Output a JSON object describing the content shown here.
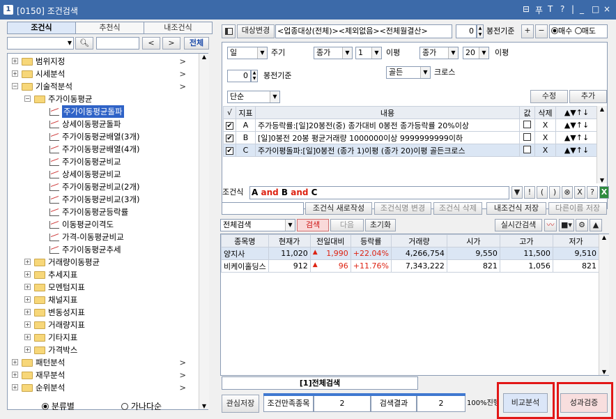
{
  "window": {
    "number": "1",
    "title": "[0150] 조건검색",
    "controls": [
      "⊟",
      "푸",
      "T",
      "?",
      "|",
      "_",
      "□",
      "×"
    ]
  },
  "left": {
    "tabs": [
      "조건식",
      "추천식",
      "내조건식"
    ],
    "nav": {
      "prev": "<",
      "next": ">",
      "all": "전체"
    },
    "tree": [
      {
        "label": "범위지정",
        "level": 0,
        "type": "folder",
        "expanded": false,
        "arrow": ">"
      },
      {
        "label": "시세분석",
        "level": 0,
        "type": "folder",
        "expanded": false,
        "arrow": ">"
      },
      {
        "label": "기술적분석",
        "level": 0,
        "type": "folder",
        "expanded": true,
        "arrow": ">"
      },
      {
        "label": "주가이동평균",
        "level": 1,
        "type": "folder",
        "expanded": true,
        "arrow": ""
      },
      {
        "label": "주가이동평균돌파",
        "level": 2,
        "type": "item",
        "selected": true
      },
      {
        "label": "상세이동평균돌파",
        "level": 2,
        "type": "item"
      },
      {
        "label": "주가이동평균배열(3개)",
        "level": 2,
        "type": "item"
      },
      {
        "label": "주가이동평균배열(4개)",
        "level": 2,
        "type": "item"
      },
      {
        "label": "주가이동평균비교",
        "level": 2,
        "type": "item"
      },
      {
        "label": "상세이동평균비교",
        "level": 2,
        "type": "item"
      },
      {
        "label": "주가이동평균비교(2개)",
        "level": 2,
        "type": "item"
      },
      {
        "label": "주가이동평균비교(3개)",
        "level": 2,
        "type": "item"
      },
      {
        "label": "주가이동평균등락률",
        "level": 2,
        "type": "item"
      },
      {
        "label": "이동평균이격도",
        "level": 2,
        "type": "item"
      },
      {
        "label": "가격-이동평균비교",
        "level": 2,
        "type": "item"
      },
      {
        "label": "주가이동평균추세",
        "level": 2,
        "type": "item"
      },
      {
        "label": "거래량이동평균",
        "level": 1,
        "type": "folder",
        "expanded": false
      },
      {
        "label": "추세지표",
        "level": 1,
        "type": "folder",
        "expanded": false
      },
      {
        "label": "모멘텀지표",
        "level": 1,
        "type": "folder",
        "expanded": false
      },
      {
        "label": "채널지표",
        "level": 1,
        "type": "folder",
        "expanded": false
      },
      {
        "label": "변동성지표",
        "level": 1,
        "type": "folder",
        "expanded": false
      },
      {
        "label": "거래량지표",
        "level": 1,
        "type": "folder",
        "expanded": false
      },
      {
        "label": "기타지표",
        "level": 1,
        "type": "folder",
        "expanded": false
      },
      {
        "label": "가격박스",
        "level": 1,
        "type": "folder",
        "expanded": false
      },
      {
        "label": "패턴분석",
        "level": 0,
        "type": "folder",
        "expanded": false,
        "arrow": ">"
      },
      {
        "label": "재무분석",
        "level": 0,
        "type": "folder",
        "expanded": false,
        "arrow": ">"
      },
      {
        "label": "순위분석",
        "level": 0,
        "type": "folder",
        "expanded": false,
        "arrow": ">"
      }
    ],
    "sort": {
      "opt1": "분류별",
      "opt2": "가나다순"
    }
  },
  "top": {
    "target_btn": "대상변경",
    "target_text": "<업종대상(전체)><제외없음><전체월결산>",
    "day_offset": "0",
    "day_offset_label": "봉전기준",
    "plus": "+",
    "minus": "−",
    "buy": "매수",
    "sell": "매도"
  },
  "form": {
    "period": "일",
    "period_label": "주기",
    "price1": "종가",
    "n1": "1",
    "ma1": "이평",
    "price2": "종가",
    "n2": "20",
    "ma2": "이평",
    "cross": "골든",
    "cross_label": "크로스",
    "offset": "0",
    "offset_label": "봉전기준",
    "mode": "단순",
    "modify": "수정",
    "add": "추가"
  },
  "conditions": {
    "headers": [
      "√",
      "지표",
      "내용",
      "값",
      "삭제",
      "▲▼↑↓"
    ],
    "rows": [
      {
        "checked": "✔",
        "id": "A",
        "content": "주가등락률:[일]20봉전(중) 종가대비 0봉전 종가등락률 20%이상",
        "del": "X",
        "moves": "▲▼↑↓"
      },
      {
        "checked": "✔",
        "id": "B",
        "content": "[일]0봉전 20봉 평균거래량 1000000이상 9999999999이하",
        "del": "X",
        "moves": "▲▼↑↓"
      },
      {
        "checked": "✔",
        "id": "C",
        "content": "주가이평돌파:[일]0봉전 (종가 1)이평 (종가 20)이평 골든크로스",
        "del": "X",
        "moves": "▲▼↑↓"
      }
    ]
  },
  "expr": {
    "label": "조건식",
    "a": "A",
    "and1": "and",
    "b": "B",
    "and2": "and",
    "c": "C",
    "ops": [
      "▼",
      "!",
      "(",
      ")",
      "⊗",
      "X",
      "?"
    ]
  },
  "actions": {
    "new": "조건식 새로작성",
    "rename": "조건식명 변경",
    "delete": "조건식 삭제",
    "save": "내조건식 저장",
    "saveas": "다른이름 저장"
  },
  "search": {
    "scope": "전체검색",
    "search": "검색",
    "next": "다음",
    "reset": "초기화",
    "realtime": "실시간검색"
  },
  "results": {
    "headers": [
      "종목명",
      "현재가",
      "전일대비",
      "등락률",
      "거래량",
      "시가",
      "고가",
      "저가"
    ],
    "rows": [
      {
        "name": "양지사",
        "price": "11,020",
        "change": "1,990",
        "rate": "+22.04%",
        "volume": "4,266,754",
        "open": "9,550",
        "high": "11,500",
        "low": "9,510"
      },
      {
        "name": "비케이홀딩스",
        "price": "912",
        "change": "96",
        "rate": "+11.76%",
        "volume": "7,343,222",
        "open": "821",
        "high": "1,056",
        "low": "821"
      }
    ]
  },
  "bottom": {
    "tab": "[1]전체검색",
    "save_interest": "관심저장",
    "matched_label": "조건만족종목",
    "matched": "2",
    "result_label": "검색결과",
    "result": "2",
    "progress": "100%진행",
    "progress_value": 1.0,
    "compare": "비교분석",
    "verify": "성과검증"
  },
  "colors": {
    "title": "#3c6aa9",
    "selected": "#2f63c7",
    "rise": "#d21"
  }
}
